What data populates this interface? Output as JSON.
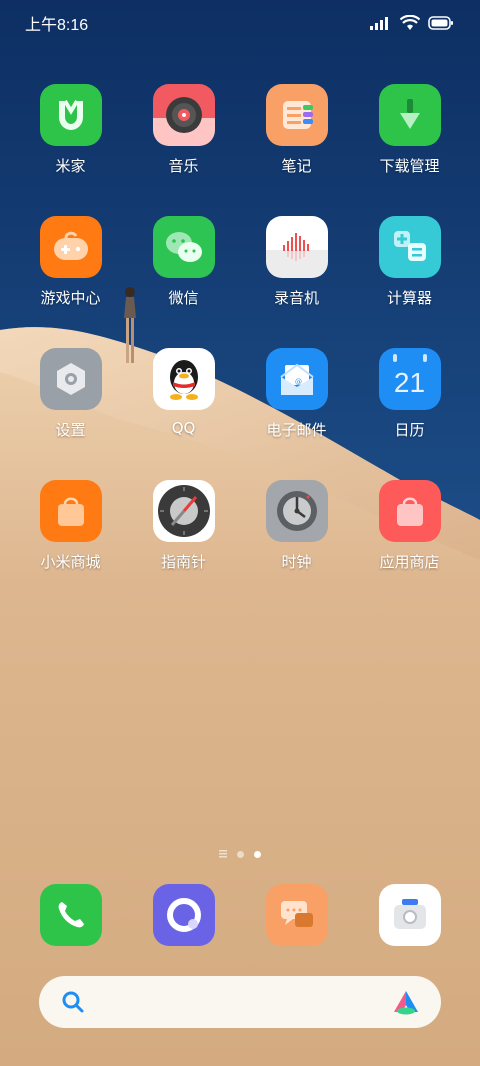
{
  "status_bar": {
    "time": "上午8:16",
    "battery_icon": "battery-icon",
    "wifi_icon": "wifi-icon",
    "signal_icon": "signal-icon"
  },
  "apps": [
    {
      "label": "米家",
      "icon": "mijia-icon",
      "color": "#2ec44a"
    },
    {
      "label": "音乐",
      "icon": "music-icon",
      "color": "#f25a62"
    },
    {
      "label": "笔记",
      "icon": "notes-icon",
      "color": "#f9a066"
    },
    {
      "label": "下载管理",
      "icon": "download-icon",
      "color": "#2ec44a"
    },
    {
      "label": "游戏中心",
      "icon": "game-center-icon",
      "color": "#ff7a12"
    },
    {
      "label": "微信",
      "icon": "wechat-icon",
      "color": "#2dc453"
    },
    {
      "label": "录音机",
      "icon": "recorder-icon",
      "color": "#ffffff"
    },
    {
      "label": "计算器",
      "icon": "calculator-icon",
      "color": "#36c9d6"
    },
    {
      "label": "设置",
      "icon": "settings-icon",
      "color": "#9aa0a8"
    },
    {
      "label": "QQ",
      "icon": "qq-icon",
      "color": "#ffffff"
    },
    {
      "label": "电子邮件",
      "icon": "email-icon",
      "color": "#1e8ef5"
    },
    {
      "label": "日历",
      "icon": "calendar-icon",
      "color": "#1e8ef5",
      "day": "21"
    },
    {
      "label": "小米商城",
      "icon": "mi-store-icon",
      "color": "#ff7a12"
    },
    {
      "label": "指南针",
      "icon": "compass-icon",
      "color": "#ffffff"
    },
    {
      "label": "时钟",
      "icon": "clock-icon",
      "color": "#a3a6aa"
    },
    {
      "label": "应用商店",
      "icon": "app-store-icon",
      "color": "#ff5a5a"
    }
  ],
  "pager": {
    "pages": 3,
    "current": 3
  },
  "dock": [
    {
      "icon": "phone-icon",
      "color": "#2ec44a"
    },
    {
      "icon": "browser-icon",
      "color": "#6a63e6"
    },
    {
      "icon": "messages-icon",
      "color": "#f9a066"
    },
    {
      "icon": "camera-icon",
      "color": "#ffffff"
    }
  ],
  "search_bar": {
    "left_icon": "search-icon",
    "right_icon": "assistant-icon"
  }
}
